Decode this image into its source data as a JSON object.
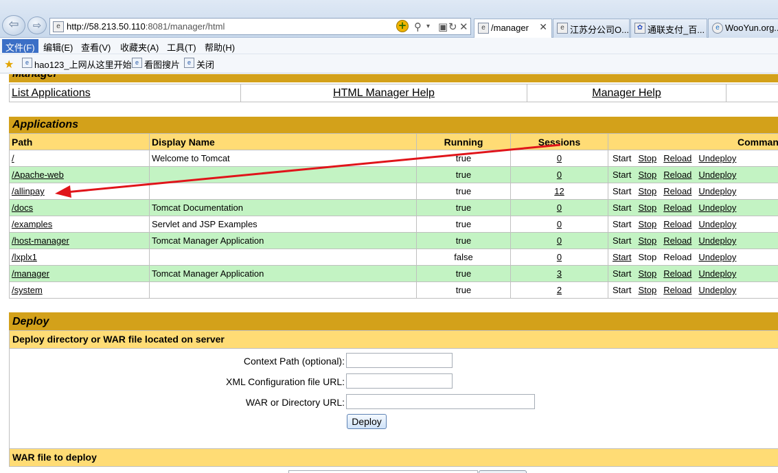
{
  "browser": {
    "url_host": "http://58.213.50.110",
    "url_rest": ":8081/manager/html",
    "tabs": [
      {
        "label": "/manager",
        "close": "✕"
      },
      {
        "label": "江苏分公司O..."
      },
      {
        "label": "通联支付_百..."
      },
      {
        "label": "WooYun.org..."
      }
    ],
    "menu": [
      "文件(F)",
      "编辑(E)",
      "查看(V)",
      "收藏夹(A)",
      "工具(T)",
      "帮助(H)"
    ],
    "favorites": [
      "hao123_上网从这里开始",
      "看图搜片",
      "关闭"
    ]
  },
  "manager": {
    "section_title": "Manager",
    "nav_links": [
      "List Applications",
      "HTML Manager Help",
      "Manager Help"
    ]
  },
  "applications": {
    "title": "Applications",
    "columns": [
      "Path",
      "Display Name",
      "Running",
      "Sessions",
      "Commands"
    ],
    "rows": [
      {
        "path": "/",
        "display": "Welcome to Tomcat",
        "running": "true",
        "sessions": "0"
      },
      {
        "path": "/Apache-web",
        "display": "",
        "running": "true",
        "sessions": "0"
      },
      {
        "path": "/allinpay",
        "display": "",
        "running": "true",
        "sessions": "12"
      },
      {
        "path": "/docs",
        "display": "Tomcat Documentation",
        "running": "true",
        "sessions": "0"
      },
      {
        "path": "/examples",
        "display": "Servlet and JSP Examples",
        "running": "true",
        "sessions": "0"
      },
      {
        "path": "/host-manager",
        "display": "Tomcat Manager Application",
        "running": "true",
        "sessions": "0"
      },
      {
        "path": "/lxplx1",
        "display": "",
        "running": "false",
        "sessions": "0"
      },
      {
        "path": "/manager",
        "display": "Tomcat Manager Application",
        "running": "true",
        "sessions": "3"
      },
      {
        "path": "/system",
        "display": "",
        "running": "true",
        "sessions": "2"
      }
    ],
    "commands": {
      "start": "Start",
      "stop": "Stop",
      "reload": "Reload",
      "undeploy": "Undeploy"
    }
  },
  "deploy": {
    "title": "Deploy",
    "server_subtitle": "Deploy directory or WAR file located on server",
    "context_path_label": "Context Path (optional):",
    "xml_config_label": "XML Configuration file URL:",
    "war_dir_label": "WAR or Directory URL:",
    "deploy_button": "Deploy",
    "war_file_subtitle": "WAR file to deploy"
  },
  "annotation_color": "#e0141a"
}
